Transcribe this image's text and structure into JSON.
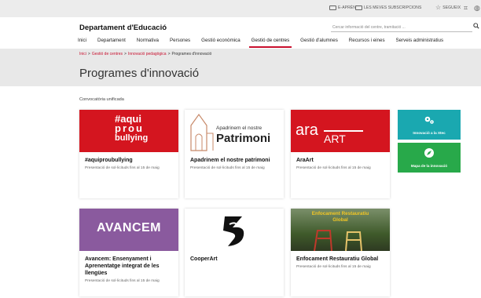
{
  "utility": {
    "eaprens": "E-APRÈN",
    "subscriptions": "LES MEVES SUBSCRIPCIONS",
    "follow": "SEGUEIX"
  },
  "header": {
    "brand": "Departament d'Educació",
    "search_placeholder": "Cercar informació del centre, tramitació ..."
  },
  "nav": {
    "items": [
      "Inici",
      "Departament",
      "Normativa",
      "Persones",
      "Gestió econòmica",
      "Gestió de centres",
      "Gestió d'alumnes",
      "Recursos i eines",
      "Serveis administratius"
    ],
    "active_index": 5
  },
  "breadcrumb": {
    "items": [
      "Inici",
      "Gestió de centres",
      "Innovació pedagògica"
    ],
    "separator": ">",
    "current": "Programes d'innovació"
  },
  "page": {
    "title": "Programes d'innovació",
    "section_label": "Convocatòria unificada"
  },
  "cards": [
    {
      "title": "#aquiproubullying",
      "subtitle": "Presentació de sol·licituds fins al 15 de maig",
      "logo_lines": [
        "#aqui",
        "prou",
        "bullying"
      ]
    },
    {
      "title": "Apadrinem el nostre patrimoni",
      "subtitle": "Presentació de sol·licituds fins al 15 de maig",
      "logo_small": "Apadrinem el nostre",
      "logo_big": "Patrimoni"
    },
    {
      "title": "AraArt",
      "subtitle": "Presentació de sol·licituds fins al 15 de maig",
      "logo_a": "ara",
      "logo_b": "ART"
    },
    {
      "title": "Avancem: Ensenyament i Aprenentatge integrat de les llengües",
      "subtitle": "Presentació de sol·licituds fins al 15 de maig",
      "logo": "AVANCEM"
    },
    {
      "title": "CooperArt",
      "subtitle": ""
    },
    {
      "title": "Enfocament Restauratiu Global",
      "subtitle": "Presentació de sol·licituds fins al 15 de maig",
      "logo_lines": [
        "Enfocament Restauratiu",
        "Global"
      ]
    }
  ],
  "side_links": [
    {
      "label": "Innovació a la Xtec",
      "icon": "gears-icon",
      "color": "#1aa8b0"
    },
    {
      "label": "Mapa de la innovació",
      "icon": "compass-icon",
      "color": "#28a94a"
    }
  ],
  "colors": {
    "accent": "#c8102e",
    "aquiprou": "#d4151f",
    "araart": "#d4151f",
    "avancem": "#8a5a9e",
    "restauratiu": "#5b7a2e"
  }
}
